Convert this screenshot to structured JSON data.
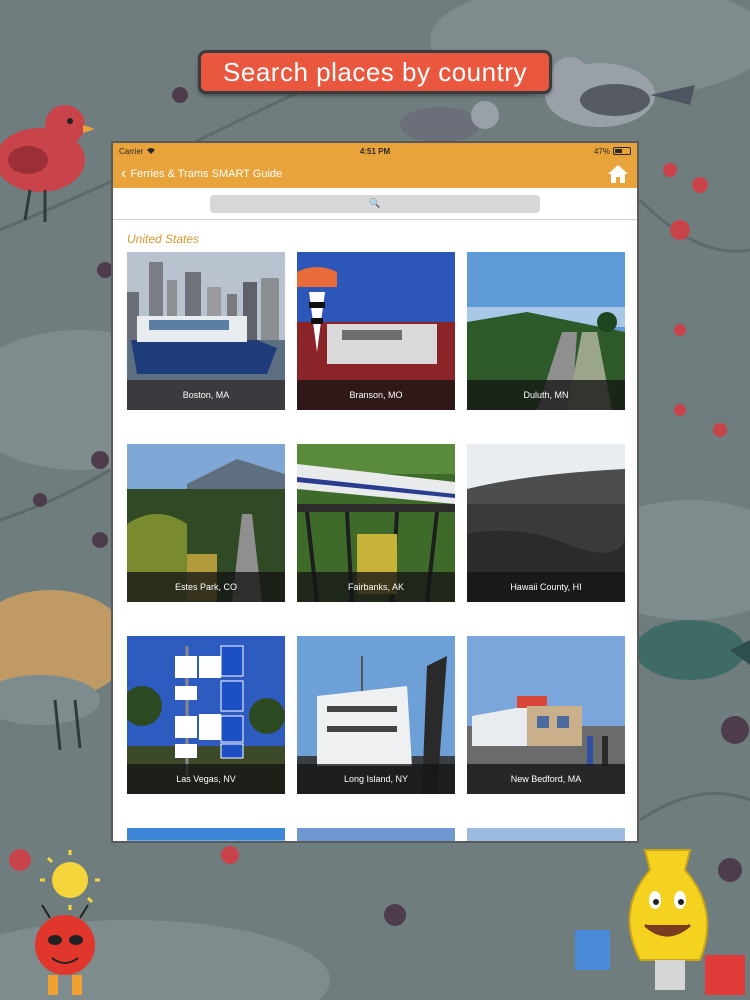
{
  "banner": {
    "text": "Search places by country"
  },
  "status_bar": {
    "carrier": "Carrier",
    "time": "4:51 PM",
    "battery": "47%"
  },
  "nav": {
    "back_label": "Ferries & Trams SMART Guide",
    "home_icon": "home-icon"
  },
  "search": {
    "placeholder": ""
  },
  "section": {
    "title": "United States"
  },
  "places": [
    {
      "name": "Boston, MA"
    },
    {
      "name": "Branson, MO"
    },
    {
      "name": "Duluth, MN"
    },
    {
      "name": "Estes Park, CO"
    },
    {
      "name": "Fairbanks, AK"
    },
    {
      "name": "Hawaii County, HI"
    },
    {
      "name": "Las Vegas, NV"
    },
    {
      "name": "Long Island, NY"
    },
    {
      "name": "New Bedford, MA"
    }
  ],
  "colors": {
    "accent": "#e8a43a",
    "banner": "#e9573f",
    "section_title": "#d49a2f"
  }
}
